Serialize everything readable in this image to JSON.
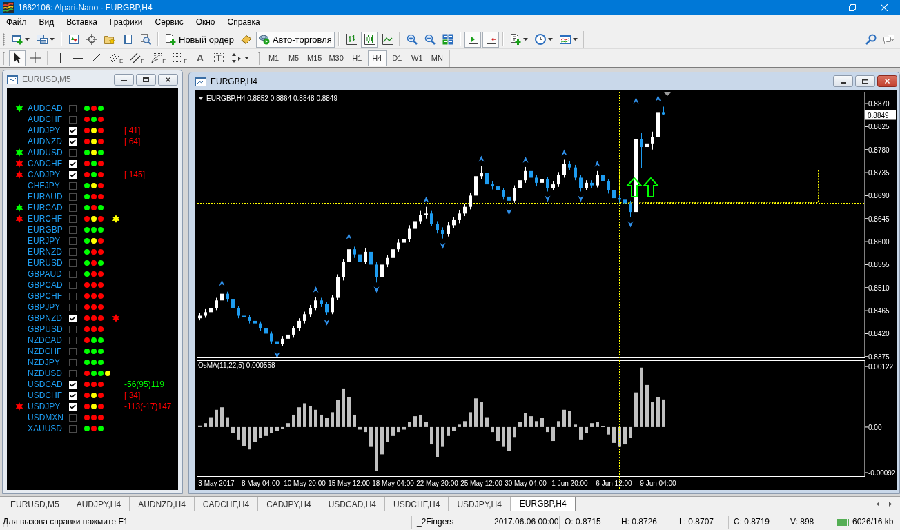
{
  "window": {
    "title": "1662106: Alpari-Nano - EURGBP,H4"
  },
  "menu": [
    "Файл",
    "Вид",
    "Вставка",
    "Графики",
    "Сервис",
    "Окно",
    "Справка"
  ],
  "toolbar": [
    {
      "kind": "icon",
      "pressed": false,
      "dropdown": true
    },
    {
      "kind": "icon",
      "pressed": false,
      "dropdown": true
    },
    {
      "kind": "separator"
    },
    {
      "kind": "icon",
      "pressed": false
    },
    {
      "kind": "icon",
      "pressed": false
    },
    {
      "kind": "icon",
      "pressed": false
    },
    {
      "kind": "icon",
      "pressed": false
    },
    {
      "kind": "icon",
      "pressed": false
    },
    {
      "kind": "separator"
    },
    {
      "kind": "text",
      "label": "Новый ордер",
      "pressed": false
    },
    {
      "kind": "icon",
      "pressed": false
    },
    {
      "kind": "text",
      "label": "Авто-торговля",
      "pressed": true
    },
    {
      "kind": "separator"
    },
    {
      "kind": "icon",
      "pressed": false
    },
    {
      "kind": "icon",
      "pressed": true
    },
    {
      "kind": "icon",
      "pressed": false
    },
    {
      "kind": "separator"
    },
    {
      "kind": "icon",
      "pressed": false
    },
    {
      "kind": "icon",
      "pressed": false
    },
    {
      "kind": "icon",
      "pressed": false
    },
    {
      "kind": "separator"
    },
    {
      "kind": "icon",
      "pressed": true
    },
    {
      "kind": "icon",
      "pressed": true
    },
    {
      "kind": "separator"
    },
    {
      "kind": "icon",
      "pressed": false,
      "dropdown": true
    },
    {
      "kind": "icon",
      "pressed": false,
      "dropdown": true
    },
    {
      "kind": "icon",
      "pressed": false,
      "dropdown": true
    }
  ],
  "drawing_tools": [
    {
      "kind": "icon",
      "pressed": true
    },
    {
      "kind": "icon",
      "pressed": false
    },
    {
      "kind": "separator"
    },
    {
      "kind": "icon",
      "pressed": false
    },
    {
      "kind": "icon",
      "pressed": false
    },
    {
      "kind": "icon",
      "pressed": false
    },
    {
      "kind": "icon",
      "pressed": false,
      "sub": "E"
    },
    {
      "kind": "icon",
      "pressed": false,
      "sub": "F"
    },
    {
      "kind": "icon",
      "pressed": false,
      "sub": "F"
    },
    {
      "kind": "icon",
      "pressed": false,
      "sub": "F"
    },
    {
      "kind": "glyph",
      "glyph": "A",
      "pressed": false
    },
    {
      "kind": "boxed-glyph",
      "glyph": "T",
      "pressed": false
    },
    {
      "kind": "icon",
      "pressed": false,
      "dropdown": true
    }
  ],
  "periods": [
    {
      "label": "M1",
      "selected": false
    },
    {
      "label": "M5",
      "selected": false
    },
    {
      "label": "M15",
      "selected": false
    },
    {
      "label": "M30",
      "selected": false
    },
    {
      "label": "H1",
      "selected": false
    },
    {
      "label": "H4",
      "selected": true
    },
    {
      "label": "D1",
      "selected": false
    },
    {
      "label": "W1",
      "selected": false
    },
    {
      "label": "MN",
      "selected": false
    }
  ],
  "dashboard": {
    "title": "EURUSD,M5",
    "active": false,
    "rows": [
      {
        "symbol": "AUDCAD",
        "star": {
          "color": "#00ff00"
        },
        "checked": false,
        "dots": [
          {
            "color": "#00ff00"
          },
          {
            "color": "#ff0000"
          },
          {
            "color": "#00ff00"
          }
        ]
      },
      {
        "symbol": "AUDCHF",
        "checked": false,
        "dots": [
          {
            "color": "#ff0000"
          },
          {
            "color": "#00ff00"
          },
          {
            "color": "#ff0000"
          }
        ]
      },
      {
        "symbol": "AUDJPY",
        "checked": true,
        "dots": [
          {
            "color": "#ff0000"
          },
          {
            "color": "#ffff00"
          },
          {
            "color": "#ff0000"
          }
        ],
        "note": {
          "text": "[ 41]",
          "color": "#ff0000"
        }
      },
      {
        "symbol": "AUDNZD",
        "checked": true,
        "dots": [
          {
            "color": "#ff0000"
          },
          {
            "color": "#ffff00"
          },
          {
            "color": "#ff0000"
          }
        ],
        "note": {
          "text": "[ 64]",
          "color": "#ff0000"
        }
      },
      {
        "symbol": "AUDUSD",
        "star": {
          "color": "#00ff00"
        },
        "checked": false,
        "dots": [
          {
            "color": "#00ff00"
          },
          {
            "color": "#ffff00"
          },
          {
            "color": "#00ff00"
          }
        ]
      },
      {
        "symbol": "CADCHF",
        "star": {
          "color": "#ff0000"
        },
        "checked": true,
        "dots": [
          {
            "color": "#ff0000"
          },
          {
            "color": "#00ff00"
          },
          {
            "color": "#ff0000"
          }
        ]
      },
      {
        "symbol": "CADJPY",
        "star": {
          "color": "#ff0000"
        },
        "checked": true,
        "dots": [
          {
            "color": "#ff0000"
          },
          {
            "color": "#00ff00"
          },
          {
            "color": "#ff0000"
          }
        ],
        "note": {
          "text": "[ 145]",
          "color": "#ff0000"
        }
      },
      {
        "symbol": "CHFJPY",
        "checked": false,
        "dots": [
          {
            "color": "#00ff00"
          },
          {
            "color": "#ffff00"
          },
          {
            "color": "#ff0000"
          }
        ]
      },
      {
        "symbol": "EURAUD",
        "checked": false,
        "dots": [
          {
            "color": "#00ff00"
          },
          {
            "color": "#ff0000"
          },
          {
            "color": "#ff0000"
          }
        ]
      },
      {
        "symbol": "EURCAD",
        "star": {
          "color": "#00ff00"
        },
        "checked": false,
        "dots": [
          {
            "color": "#00ff00"
          },
          {
            "color": "#ff0000"
          },
          {
            "color": "#00ff00"
          }
        ]
      },
      {
        "symbol": "EURCHF",
        "star": {
          "color": "#ff0000"
        },
        "checked": false,
        "dots": [
          {
            "color": "#ff0000"
          },
          {
            "color": "#ffff00"
          },
          {
            "color": "#ff0000"
          }
        ],
        "signal": {
          "color": "#ffff00"
        }
      },
      {
        "symbol": "EURGBP",
        "checked": false,
        "dots": [
          {
            "color": "#00ff00"
          },
          {
            "color": "#00ff00"
          },
          {
            "color": "#00ff00"
          }
        ]
      },
      {
        "symbol": "EURJPY",
        "checked": false,
        "dots": [
          {
            "color": "#00ff00"
          },
          {
            "color": "#ffff00"
          },
          {
            "color": "#ff0000"
          }
        ]
      },
      {
        "symbol": "EURNZD",
        "checked": false,
        "dots": [
          {
            "color": "#00ff00"
          },
          {
            "color": "#ff0000"
          },
          {
            "color": "#ff0000"
          }
        ]
      },
      {
        "symbol": "EURUSD",
        "checked": false,
        "dots": [
          {
            "color": "#00ff00"
          },
          {
            "color": "#ff0000"
          },
          {
            "color": "#00ff00"
          }
        ]
      },
      {
        "symbol": "GBPAUD",
        "checked": false,
        "dots": [
          {
            "color": "#00ff00"
          },
          {
            "color": "#ff0000"
          },
          {
            "color": "#ff0000"
          }
        ]
      },
      {
        "symbol": "GBPCAD",
        "checked": false,
        "dots": [
          {
            "color": "#ff0000"
          },
          {
            "color": "#ff0000"
          },
          {
            "color": "#ff0000"
          }
        ]
      },
      {
        "symbol": "GBPCHF",
        "checked": false,
        "dots": [
          {
            "color": "#ff0000"
          },
          {
            "color": "#ff0000"
          },
          {
            "color": "#ff0000"
          }
        ]
      },
      {
        "symbol": "GBPJPY",
        "checked": false,
        "dots": [
          {
            "color": "#ff0000"
          },
          {
            "color": "#ff0000"
          },
          {
            "color": "#ff0000"
          }
        ]
      },
      {
        "symbol": "GBPNZD",
        "checked": true,
        "dots": [
          {
            "color": "#ff0000"
          },
          {
            "color": "#ff0000"
          },
          {
            "color": "#ff0000"
          }
        ],
        "signal": {
          "color": "#ff0000"
        }
      },
      {
        "symbol": "GBPUSD",
        "checked": false,
        "dots": [
          {
            "color": "#ff0000"
          },
          {
            "color": "#ff0000"
          },
          {
            "color": "#ff0000"
          }
        ]
      },
      {
        "symbol": "NZDCAD",
        "checked": false,
        "dots": [
          {
            "color": "#ff0000"
          },
          {
            "color": "#00ff00"
          },
          {
            "color": "#00ff00"
          }
        ]
      },
      {
        "symbol": "NZDCHF",
        "checked": false,
        "dots": [
          {
            "color": "#00ff00"
          },
          {
            "color": "#00ff00"
          },
          {
            "color": "#00ff00"
          }
        ]
      },
      {
        "symbol": "NZDJPY",
        "checked": false,
        "dots": [
          {
            "color": "#00ff00"
          },
          {
            "color": "#00ff00"
          },
          {
            "color": "#00ff00"
          }
        ]
      },
      {
        "symbol": "NZDUSD",
        "checked": false,
        "dots": [
          {
            "color": "#ff0000"
          },
          {
            "color": "#00ff00"
          },
          {
            "color": "#00ff00"
          },
          {
            "color": "#ffff00"
          }
        ]
      },
      {
        "symbol": "USDCAD",
        "checked": true,
        "dots": [
          {
            "color": "#ff0000"
          },
          {
            "color": "#ff0000"
          },
          {
            "color": "#ff0000"
          }
        ],
        "note": {
          "text": "-56(95)119",
          "color": "#00ff00"
        }
      },
      {
        "symbol": "USDCHF",
        "checked": true,
        "dots": [
          {
            "color": "#ff0000"
          },
          {
            "color": "#ffff00"
          },
          {
            "color": "#ff0000"
          }
        ],
        "note": {
          "text": "[ 34]",
          "color": "#ff0000"
        }
      },
      {
        "symbol": "USDJPY",
        "star": {
          "color": "#ff0000"
        },
        "checked": true,
        "dots": [
          {
            "color": "#ff0000"
          },
          {
            "color": "#ffff00"
          },
          {
            "color": "#ff0000"
          }
        ],
        "note": {
          "text": "-113(-17)147",
          "color": "#ff0000"
        }
      },
      {
        "symbol": "USDMXN",
        "checked": false,
        "dots": [
          {
            "color": "#ff0000"
          },
          {
            "color": "#ff0000"
          },
          {
            "color": "#ff0000"
          }
        ]
      },
      {
        "symbol": "XAUUSD",
        "checked": false,
        "dots": [
          {
            "color": "#00ff00"
          },
          {
            "color": "#ff0000"
          },
          {
            "color": "#00ff00"
          }
        ]
      }
    ]
  },
  "chart_window": {
    "title": "EURGBP,H4",
    "active": true,
    "chart_data": [
      {
        "type": "candlestick",
        "title": "EURGBP,H4 0.8852 0.8864 0.8848 0.8849",
        "tick_labels": "y",
        "ylim": [
          0.8372,
          0.8893
        ],
        "yticks": [
          {
            "value": 0.887,
            "label": "0.8870"
          },
          {
            "value": 0.8825,
            "label": "0.8825"
          },
          {
            "value": 0.878,
            "label": "0.8780"
          },
          {
            "value": 0.8735,
            "label": "0.8735"
          },
          {
            "value": 0.869,
            "label": "0.8690"
          },
          {
            "value": 0.8645,
            "label": "0.8645"
          },
          {
            "value": 0.86,
            "label": "0.8600"
          },
          {
            "value": 0.8555,
            "label": "0.8555"
          },
          {
            "value": 0.851,
            "label": "0.8510"
          },
          {
            "value": 0.8465,
            "label": "0.8465"
          },
          {
            "value": 0.842,
            "label": "0.8420"
          },
          {
            "value": 0.8375,
            "label": "0.8375"
          }
        ],
        "ref_lines": [
          {
            "axis": "y",
            "value": 0.8849,
            "label": "0.8849",
            "color": "#8fa3b8"
          },
          {
            "axis": "y",
            "value": 0.8676,
            "color": "#ffff00",
            "line_style": "dotted"
          }
        ],
        "ohlc": [
          [
            0.845,
            0.8461,
            0.8446,
            0.8455
          ],
          [
            0.8455,
            0.8468,
            0.8451,
            0.8462
          ],
          [
            0.8462,
            0.8476,
            0.8458,
            0.847
          ],
          [
            0.847,
            0.849,
            0.8466,
            0.8485
          ],
          [
            0.8485,
            0.8505,
            0.848,
            0.8498
          ],
          [
            0.8498,
            0.8502,
            0.8483,
            0.8488
          ],
          [
            0.8488,
            0.8492,
            0.8465,
            0.847
          ],
          [
            0.847,
            0.8474,
            0.845,
            0.8455
          ],
          [
            0.8455,
            0.8462,
            0.8447,
            0.8452
          ],
          [
            0.8452,
            0.8456,
            0.844,
            0.8445
          ],
          [
            0.8445,
            0.845,
            0.8435,
            0.844
          ],
          [
            0.844,
            0.8444,
            0.8425,
            0.843
          ],
          [
            0.843,
            0.8434,
            0.8414,
            0.842
          ],
          [
            0.842,
            0.8424,
            0.84,
            0.8405
          ],
          [
            0.8405,
            0.841,
            0.8392,
            0.84
          ],
          [
            0.84,
            0.8415,
            0.8395,
            0.841
          ],
          [
            0.841,
            0.8423,
            0.8404,
            0.8418
          ],
          [
            0.8418,
            0.8435,
            0.8412,
            0.843
          ],
          [
            0.843,
            0.845,
            0.8425,
            0.8445
          ],
          [
            0.8445,
            0.8463,
            0.844,
            0.8458
          ],
          [
            0.8458,
            0.8476,
            0.8452,
            0.847
          ],
          [
            0.847,
            0.8492,
            0.8466,
            0.8485
          ],
          [
            0.8485,
            0.849,
            0.8472,
            0.8478
          ],
          [
            0.8478,
            0.8482,
            0.8456,
            0.8462
          ],
          [
            0.8462,
            0.8495,
            0.8458,
            0.849
          ],
          [
            0.849,
            0.8536,
            0.8486,
            0.853
          ],
          [
            0.853,
            0.8566,
            0.8524,
            0.856
          ],
          [
            0.856,
            0.8596,
            0.8555,
            0.8585
          ],
          [
            0.8585,
            0.859,
            0.8568,
            0.8575
          ],
          [
            0.8575,
            0.858,
            0.8552,
            0.856
          ],
          [
            0.856,
            0.8588,
            0.8556,
            0.858
          ],
          [
            0.858,
            0.8584,
            0.8548,
            0.8555
          ],
          [
            0.8555,
            0.856,
            0.852,
            0.853
          ],
          [
            0.853,
            0.8562,
            0.8526,
            0.8555
          ],
          [
            0.8555,
            0.8574,
            0.855,
            0.8568
          ],
          [
            0.8568,
            0.859,
            0.8562,
            0.8585
          ],
          [
            0.8585,
            0.8604,
            0.858,
            0.8598
          ],
          [
            0.8598,
            0.8612,
            0.8592,
            0.8605
          ],
          [
            0.8605,
            0.8632,
            0.86,
            0.8625
          ],
          [
            0.8625,
            0.8646,
            0.862,
            0.864
          ],
          [
            0.864,
            0.866,
            0.8635,
            0.8652
          ],
          [
            0.8652,
            0.8668,
            0.8645,
            0.8655
          ],
          [
            0.8655,
            0.866,
            0.863,
            0.8635
          ],
          [
            0.8635,
            0.864,
            0.8616,
            0.8622
          ],
          [
            0.8622,
            0.8628,
            0.8606,
            0.8615
          ],
          [
            0.8615,
            0.8638,
            0.861,
            0.8632
          ],
          [
            0.8632,
            0.8648,
            0.8627,
            0.8642
          ],
          [
            0.8642,
            0.8661,
            0.8636,
            0.8655
          ],
          [
            0.8655,
            0.8674,
            0.865,
            0.8668
          ],
          [
            0.8668,
            0.8696,
            0.8663,
            0.869
          ],
          [
            0.869,
            0.8735,
            0.8686,
            0.8728
          ],
          [
            0.8728,
            0.8748,
            0.8722,
            0.8735
          ],
          [
            0.8735,
            0.874,
            0.8706,
            0.8712
          ],
          [
            0.8712,
            0.8718,
            0.8702,
            0.8708
          ],
          [
            0.8708,
            0.8712,
            0.8694,
            0.87
          ],
          [
            0.87,
            0.8705,
            0.8682,
            0.8688
          ],
          [
            0.8688,
            0.8692,
            0.8672,
            0.868
          ],
          [
            0.868,
            0.871,
            0.8676,
            0.8705
          ],
          [
            0.8705,
            0.8726,
            0.87,
            0.872
          ],
          [
            0.872,
            0.8746,
            0.8715,
            0.8738
          ],
          [
            0.8738,
            0.8742,
            0.872,
            0.8725
          ],
          [
            0.8725,
            0.873,
            0.8708,
            0.8715
          ],
          [
            0.8715,
            0.8728,
            0.871,
            0.8722
          ],
          [
            0.8722,
            0.8726,
            0.8698,
            0.8705
          ],
          [
            0.8705,
            0.8718,
            0.87,
            0.8712
          ],
          [
            0.8712,
            0.8736,
            0.8707,
            0.873
          ],
          [
            0.873,
            0.876,
            0.8725,
            0.8752
          ],
          [
            0.8752,
            0.8758,
            0.874,
            0.8745
          ],
          [
            0.8745,
            0.875,
            0.872,
            0.8725
          ],
          [
            0.8725,
            0.873,
            0.8698,
            0.8705
          ],
          [
            0.8705,
            0.872,
            0.87,
            0.8715
          ],
          [
            0.8715,
            0.872,
            0.8704,
            0.871
          ],
          [
            0.871,
            0.8738,
            0.8706,
            0.873
          ],
          [
            0.873,
            0.8734,
            0.8712,
            0.8718
          ],
          [
            0.8718,
            0.8722,
            0.8694,
            0.87
          ],
          [
            0.87,
            0.8705,
            0.8678,
            0.8685
          ],
          [
            0.8685,
            0.8692,
            0.8676,
            0.8682
          ],
          [
            0.8682,
            0.8688,
            0.8668,
            0.8675
          ],
          [
            0.8675,
            0.868,
            0.8648,
            0.8658
          ],
          [
            0.8658,
            0.8862,
            0.8655,
            0.88
          ],
          [
            0.88,
            0.8812,
            0.8744,
            0.8785
          ],
          [
            0.8785,
            0.8808,
            0.8775,
            0.8792
          ],
          [
            0.8792,
            0.8815,
            0.878,
            0.8805
          ],
          [
            0.8805,
            0.8866,
            0.88,
            0.8852
          ],
          [
            0.8852,
            0.8864,
            0.8848,
            0.8849
          ],
          null,
          null,
          null,
          null,
          null,
          null,
          null,
          null,
          null,
          null,
          null,
          null,
          null,
          null,
          null,
          null,
          null,
          null,
          null,
          null,
          null,
          null,
          null,
          null,
          null,
          null,
          null,
          null,
          null,
          null,
          null,
          null,
          null,
          null,
          null,
          null
        ]
      },
      {
        "type": "bar",
        "title": "OsMA(11,22,5) 0.000558",
        "color": "#c0c0c0",
        "ylim": [
          -0.00099,
          0.00135
        ],
        "yticks": [
          {
            "value": 0.001223,
            "label": "0.00122"
          },
          {
            "value": 0,
            "label": "0.00"
          },
          {
            "value": -0.00092,
            "label": "-0.00092"
          }
        ],
        "categories": [
          null,
          null,
          null,
          "3 May 2017",
          null,
          null,
          null,
          null,
          null,
          null,
          null,
          "8 May 04:00",
          null,
          null,
          null,
          null,
          null,
          null,
          null,
          "10 May 20:00",
          null,
          null,
          null,
          null,
          null,
          null,
          null,
          "15 May 12:00",
          null,
          null,
          null,
          null,
          null,
          null,
          null,
          "18 May 04:00",
          null,
          null,
          null,
          null,
          null,
          null,
          null,
          "22 May 20:00",
          null,
          null,
          null,
          null,
          null,
          null,
          null,
          "25 May 12:00",
          null,
          null,
          null,
          null,
          null,
          null,
          null,
          "30 May 04:00",
          null,
          null,
          null,
          null,
          null,
          null,
          null,
          "1 Jun 20:00",
          null,
          null,
          null,
          null,
          null,
          null,
          null,
          "6 Jun 12:00",
          null,
          null,
          null,
          null,
          null,
          null,
          null,
          "9 Jun 04:00",
          null,
          null,
          null,
          null,
          null,
          null,
          null,
          null,
          null,
          null,
          null,
          null,
          null,
          null,
          null,
          null,
          null,
          null,
          null,
          null,
          null,
          null,
          null,
          null,
          null,
          null,
          null,
          null,
          null,
          null,
          null,
          null,
          null,
          null,
          null,
          null,
          null
        ],
        "values": [
          3e-05,
          8e-05,
          0.0002,
          0.00035,
          0.0004,
          0.0002,
          -0.00012,
          -0.00025,
          -0.00038,
          -0.00045,
          -0.0003,
          -0.00022,
          -0.00018,
          -0.00012,
          -8e-05,
          -4e-05,
          8e-05,
          0.00025,
          0.0004,
          0.00048,
          0.00042,
          0.00035,
          0.00025,
          0.00018,
          0.0003,
          0.00055,
          0.00078,
          0.0006,
          0.00025,
          -5e-05,
          -0.0001,
          -0.0004,
          -0.00088,
          -0.00055,
          -0.0003,
          -0.00018,
          -0.0001,
          -5e-05,
          0.0001,
          0.00022,
          0.00025,
          0.0001,
          -0.00035,
          -0.0006,
          -0.0004,
          -0.00018,
          -8e-05,
          5e-05,
          0.00012,
          0.0003,
          0.00058,
          0.0005,
          0.0002,
          -0.0001,
          -0.00028,
          -0.0004,
          -0.00048,
          -0.0002,
          0.0001,
          0.00028,
          0.00022,
          0.00012,
          0.00018,
          -0.0001,
          -0.00028,
          0.00012,
          0.00035,
          0.00032,
          5e-05,
          -0.00025,
          -0.00012,
          8e-05,
          0.0001,
          2e-05,
          -0.00015,
          -0.00032,
          -0.0004,
          -0.00035,
          -0.00022,
          0.0007,
          0.0012,
          0.00085,
          0.0005,
          0.0006,
          0.000558,
          null,
          null,
          null,
          null,
          null,
          null,
          null,
          null,
          null,
          null,
          null,
          null,
          null,
          null,
          null,
          null,
          null,
          null,
          null,
          null,
          null,
          null,
          null,
          null,
          null,
          null,
          null,
          null,
          null,
          null,
          null,
          null,
          null,
          null,
          null,
          null
        ]
      }
    ]
  },
  "tabs": [
    {
      "label": "EURUSD,M5",
      "selected": false
    },
    {
      "label": "AUDJPY,H4",
      "selected": false
    },
    {
      "label": "AUDNZD,H4",
      "selected": false
    },
    {
      "label": "CADCHF,H4",
      "selected": false
    },
    {
      "label": "CADJPY,H4",
      "selected": false
    },
    {
      "label": "USDCAD,H4",
      "selected": false
    },
    {
      "label": "USDCHF,H4",
      "selected": false
    },
    {
      "label": "USDJPY,H4",
      "selected": false
    },
    {
      "label": "EURGBP,H4",
      "selected": true
    }
  ],
  "status_bar": {
    "help": "Для вызова справки нажмите F1",
    "profile": "_2Fingers",
    "bar_time": "2017.06.06 00:00",
    "open": "O: 0.8715",
    "high": "H: 0.8726",
    "low": "L: 0.8707",
    "close": "C: 0.8719",
    "volume": "V: 898",
    "traffic": "6026/16 kb"
  }
}
